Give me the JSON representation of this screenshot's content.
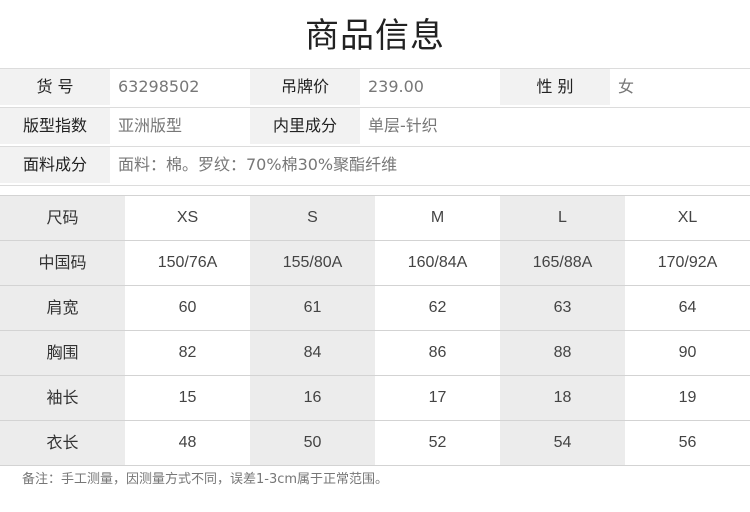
{
  "title": "商品信息",
  "info": {
    "row1": [
      {
        "label": "货  号",
        "value": "63298502"
      },
      {
        "label": "吊牌价",
        "value": "239.00"
      },
      {
        "label": "性  别",
        "value": "女"
      }
    ],
    "row2": [
      {
        "label": "版型指数",
        "value": "亚洲版型"
      },
      {
        "label": "内里成分",
        "value": "单层-针织"
      }
    ],
    "row3": [
      {
        "label": "面料成分",
        "value": "面料：棉。罗纹：70%棉30%聚酯纤维"
      }
    ]
  },
  "size_table": {
    "header": [
      "尺码",
      "XS",
      "S",
      "M",
      "L",
      "XL"
    ],
    "rows": [
      [
        "中国码",
        "150/76A",
        "155/80A",
        "160/84A",
        "165/88A",
        "170/92A"
      ],
      [
        "肩宽",
        "60",
        "61",
        "62",
        "63",
        "64"
      ],
      [
        "胸围",
        "82",
        "84",
        "86",
        "88",
        "90"
      ],
      [
        "袖长",
        "15",
        "16",
        "17",
        "18",
        "19"
      ],
      [
        "衣长",
        "48",
        "50",
        "52",
        "54",
        "56"
      ]
    ]
  },
  "note": "备注：手工测量，因测量方式不同，误差1-3cm属于正常范围。"
}
